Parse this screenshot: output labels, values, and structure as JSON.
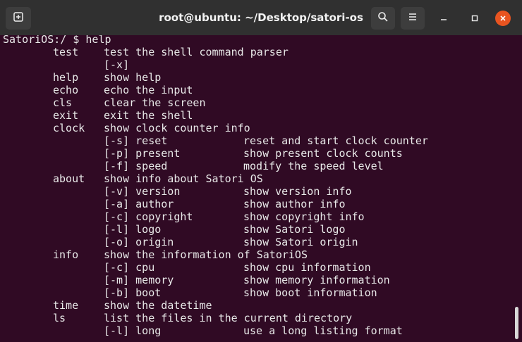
{
  "window": {
    "title": "root@ubuntu: ~/Desktop/satori-os"
  },
  "icons": {
    "new_tab": "new-tab-icon",
    "search": "search-icon",
    "menu": "hamburger-menu-icon",
    "minimize": "minimize-icon",
    "maximize": "maximize-icon",
    "close": "close-icon"
  },
  "colors": {
    "terminal_bg": "#300a24",
    "titlebar_bg": "#303030",
    "close_accent": "#e95420"
  },
  "terminal": {
    "prompt": "SatoriOS:/ $ help",
    "lines": [
      {
        "cmd": "test",
        "desc": "test the shell command parser",
        "opt": "",
        "optdesc": ""
      },
      {
        "cmd": "",
        "desc": "[-x]",
        "opt": "",
        "optdesc": ""
      },
      {
        "cmd": "help",
        "desc": "show help",
        "opt": "",
        "optdesc": ""
      },
      {
        "cmd": "echo",
        "desc": "echo the input",
        "opt": "",
        "optdesc": ""
      },
      {
        "cmd": "cls",
        "desc": "clear the screen",
        "opt": "",
        "optdesc": ""
      },
      {
        "cmd": "exit",
        "desc": "exit the shell",
        "opt": "",
        "optdesc": ""
      },
      {
        "cmd": "clock",
        "desc": "show clock counter info",
        "opt": "",
        "optdesc": ""
      },
      {
        "cmd": "",
        "desc": "[-s] reset",
        "opt": "",
        "optdesc": "reset and start clock counter"
      },
      {
        "cmd": "",
        "desc": "[-p] present",
        "opt": "",
        "optdesc": "show present clock counts"
      },
      {
        "cmd": "",
        "desc": "[-f] speed",
        "opt": "",
        "optdesc": "modify the speed level"
      },
      {
        "cmd": "about",
        "desc": "show info about Satori OS",
        "opt": "",
        "optdesc": ""
      },
      {
        "cmd": "",
        "desc": "[-v] version",
        "opt": "",
        "optdesc": "show version info"
      },
      {
        "cmd": "",
        "desc": "[-a] author",
        "opt": "",
        "optdesc": "show author info"
      },
      {
        "cmd": "",
        "desc": "[-c] copyright",
        "opt": "",
        "optdesc": "show copyright info"
      },
      {
        "cmd": "",
        "desc": "[-l] logo",
        "opt": "",
        "optdesc": "show Satori logo"
      },
      {
        "cmd": "",
        "desc": "[-o] origin",
        "opt": "",
        "optdesc": "show Satori origin"
      },
      {
        "cmd": "info",
        "desc": "show the information of SatoriOS",
        "opt": "",
        "optdesc": ""
      },
      {
        "cmd": "",
        "desc": "[-c] cpu",
        "opt": "",
        "optdesc": "show cpu information"
      },
      {
        "cmd": "",
        "desc": "[-m] memory",
        "opt": "",
        "optdesc": "show memory information"
      },
      {
        "cmd": "",
        "desc": "[-b] boot",
        "opt": "",
        "optdesc": "show boot information"
      },
      {
        "cmd": "time",
        "desc": "show the datetime",
        "opt": "",
        "optdesc": ""
      },
      {
        "cmd": "ls",
        "desc": "list the files in the current directory",
        "opt": "",
        "optdesc": ""
      },
      {
        "cmd": "",
        "desc": "[-l] long",
        "opt": "",
        "optdesc": "use a long listing format"
      }
    ]
  }
}
